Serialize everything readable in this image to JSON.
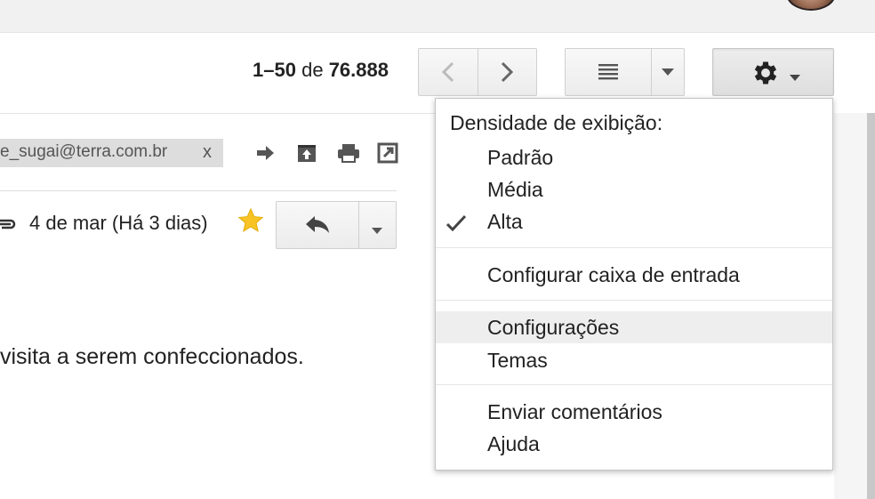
{
  "header": {
    "avatar_icon": "user-avatar-icon"
  },
  "pagination": {
    "range": "1–50",
    "of": "de",
    "total": "76.888",
    "prev_icon": "chevron-left-icon",
    "next_icon": "chevron-right-icon"
  },
  "density_button": {
    "icon": "list-density-icon",
    "dropdown_icon": "caret-down-icon"
  },
  "settings_button": {
    "icon": "gear-icon",
    "dropdown_icon": "caret-down-icon"
  },
  "message": {
    "recipient_chip": "e_sugai@terra.com.br",
    "chip_remove": "x",
    "actions": [
      "forward-icon",
      "archive-icon",
      "print-icon",
      "open-in-new-window-icon"
    ],
    "date": "4 de mar (Há 3 dias)",
    "starred": true,
    "reply_icon": "reply-icon",
    "more_icon": "caret-down-icon",
    "body_fragment": "visita a serem confeccionados."
  },
  "settings_menu": {
    "heading": "Densidade de exibição:",
    "density_options": [
      {
        "label": "Padrão",
        "checked": false
      },
      {
        "label": "Média",
        "checked": false
      },
      {
        "label": "Alta",
        "checked": true
      }
    ],
    "inbox_config": "Configurar caixa de entrada",
    "settings": "Configurações",
    "themes": "Temas",
    "feedback": "Enviar comentários",
    "help": "Ajuda",
    "highlighted_item": "Configurações"
  },
  "colors": {
    "star": "#f7c325",
    "menu_highlight": "#eeeeee",
    "chip_bg": "#dddddd",
    "icon_gray": "#666666"
  }
}
